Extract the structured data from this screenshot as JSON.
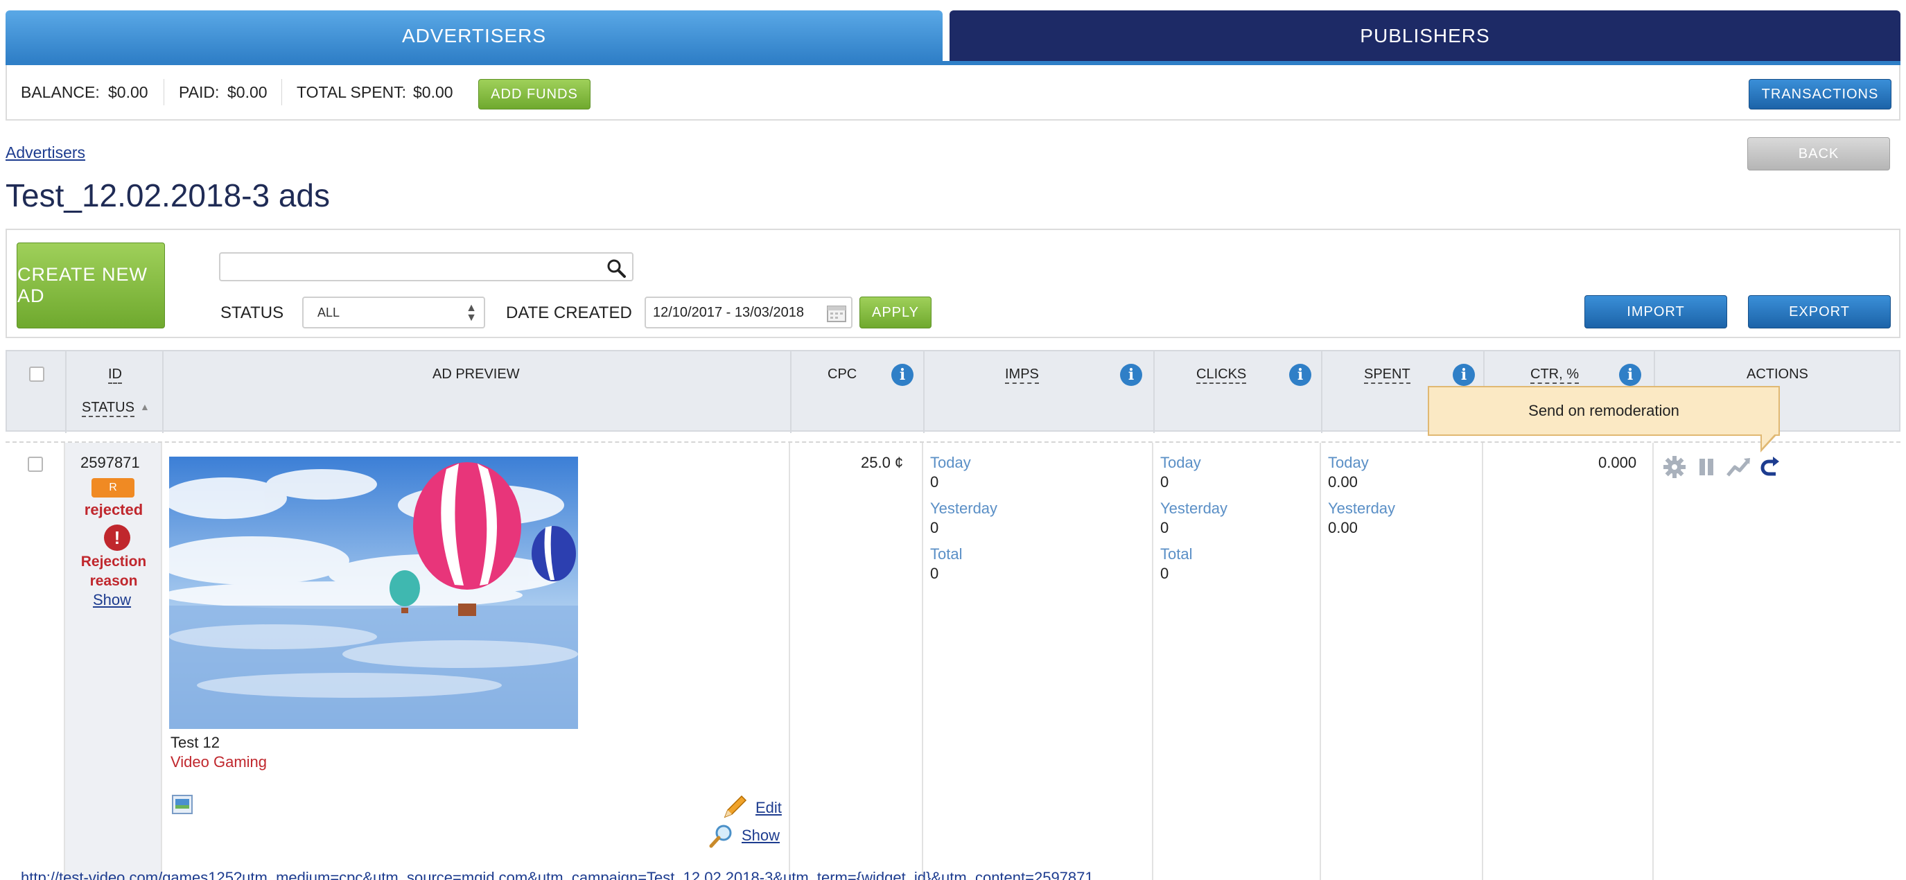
{
  "tabs": {
    "advertisers": "ADVERTISERS",
    "publishers": "PUBLISHERS"
  },
  "balance": {
    "balance_label": "BALANCE:",
    "balance_value": "$0.00",
    "paid_label": "PAID:",
    "paid_value": "$0.00",
    "spent_label": "TOTAL SPENT:",
    "spent_value": "$0.00",
    "add_funds": "ADD FUNDS",
    "transactions": "TRANSACTIONS"
  },
  "breadcrumb": "Advertisers",
  "back": "BACK",
  "page_title": "Test_12.02.2018-3 ads",
  "filters": {
    "create_new_ad": "CREATE NEW AD",
    "search_value": "",
    "status_label": "STATUS",
    "status_value": "ALL",
    "date_label": "DATE CREATED",
    "date_value": "12/10/2017 - 13/03/2018",
    "apply": "APPLY",
    "import": "IMPORT",
    "export": "EXPORT"
  },
  "table": {
    "headers": {
      "id": "ID",
      "status": "STATUS",
      "ad_preview": "AD PREVIEW",
      "cpc": "CPC",
      "imps": "IMPS",
      "clicks": "CLICKS",
      "spent": "SPENT",
      "ctr": "CTR, %",
      "actions": "ACTIONS"
    },
    "row": {
      "id": "2597871",
      "status_badge": "R",
      "status_text": "rejected",
      "rejection_reason": "Rejection reason",
      "show": "Show",
      "ad_title": "Test 12",
      "ad_category": "Video Gaming",
      "edit": "Edit",
      "preview_show": "Show",
      "cpc": "25.0 ¢",
      "imps": {
        "today_label": "Today",
        "today": "0",
        "yesterday_label": "Yesterday",
        "yesterday": "0",
        "total_label": "Total",
        "total": "0"
      },
      "clicks": {
        "today_label": "Today",
        "today": "0",
        "yesterday_label": "Yesterday",
        "yesterday": "0",
        "total_label": "Total",
        "total": "0"
      },
      "spent": {
        "today_label": "Today",
        "today": "0.00",
        "yesterday_label": "Yesterday",
        "yesterday": "0.00"
      },
      "ctr": "0.000",
      "url": "http://test-video.com/games125?utm_medium=cpc&utm_source=mgid.com&utm_campaign=Test_12.02.2018-3&utm_term={widget_id}&utm_content=2597871"
    }
  },
  "tooltip": "Send on remoderation",
  "colors": {
    "brand_blue": "#2f7fc7",
    "navy": "#1d2a66",
    "green": "#7bb536",
    "rejected_red": "#c0272d",
    "badge_orange": "#f08a23",
    "tooltip_bg": "#fbe9c4"
  }
}
